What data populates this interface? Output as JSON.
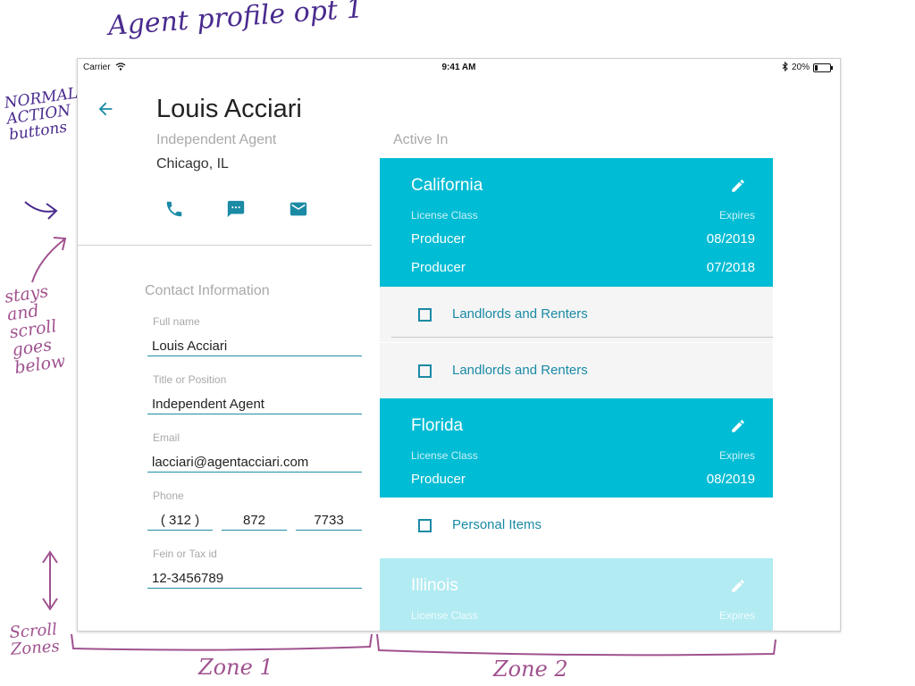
{
  "annotations": {
    "title": "Agent profile opt 1",
    "normal_action": "NORMAL\nACTION\nbuttons",
    "stays": "stays\nand\nscroll\ngoes\nbelow",
    "scroll_zones": "Scroll\nZones",
    "zone1": "Zone 1",
    "zone2": "Zone 2"
  },
  "status_bar": {
    "carrier": "Carrier",
    "time": "9:41 AM",
    "battery": "20%",
    "battery_level": 0.2
  },
  "profile": {
    "name": "Louis Acciari",
    "title": "Independent Agent",
    "location": "Chicago, IL",
    "actions": [
      {
        "icon": "phone-icon"
      },
      {
        "icon": "message-icon"
      },
      {
        "icon": "email-icon"
      }
    ]
  },
  "contact": {
    "heading": "Contact Information",
    "full_name": {
      "label": "Full name",
      "value": "Louis Acciari"
    },
    "title": {
      "label": "Title or Position",
      "value": "Independent Agent"
    },
    "email": {
      "label": "Email",
      "value": "lacciari@agentacciari.com"
    },
    "phone": {
      "label": "Phone",
      "area": "( 312 )",
      "prefix": "872",
      "line": "7733"
    },
    "fein": {
      "label": "Fein or Tax id",
      "value": "12-3456789"
    }
  },
  "active_in": {
    "heading": "Active In",
    "class_label": "License Class",
    "expires_label": "Expires",
    "states": [
      {
        "name": "California",
        "licenses": [
          {
            "class": "Producer",
            "expires": "08/2019"
          },
          {
            "class": "Producer",
            "expires": "07/2018"
          }
        ],
        "coverages": [
          "Landlords and Renters",
          "Landlords and Renters"
        ]
      },
      {
        "name": "Florida",
        "licenses": [
          {
            "class": "Producer",
            "expires": "08/2019"
          }
        ],
        "coverages": [
          "Personal Items"
        ]
      },
      {
        "name": "Illinois",
        "licenses": [],
        "coverages": []
      }
    ]
  },
  "colors": {
    "accent": "#00bcd4",
    "accent_faded": "#b2ebf2",
    "link": "#1a8aa5",
    "muted_text": "#a9a9a9",
    "annotation_purple": "#4a2b8e",
    "annotation_pink": "#a0528f"
  }
}
